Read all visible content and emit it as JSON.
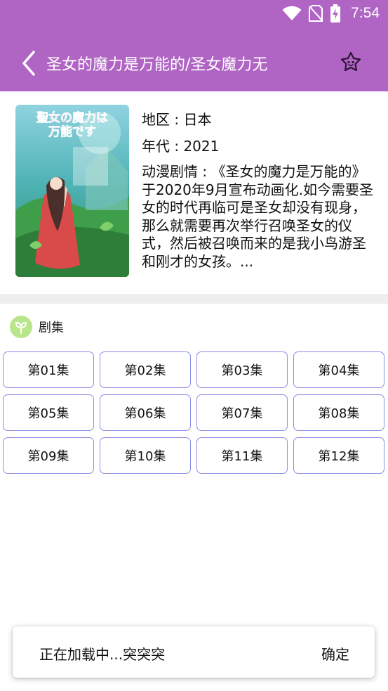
{
  "status_bar": {
    "time": "7:54",
    "icons": [
      "wifi-icon",
      "no-sim-icon",
      "battery-charging-icon"
    ]
  },
  "app_bar": {
    "title": "圣女的魔力是万能的/圣女魔力无",
    "back_icon": "back-chevron-icon",
    "favorite_icon": "star-face-icon"
  },
  "anime": {
    "poster": {
      "title_art": "聖女の魔力は万能です"
    },
    "region": "地区 : 日本",
    "year": "年代 : 2021",
    "synopsis": "动漫剧情 : 《圣女的魔力是万能的》于2020年9月宣布动画化.如今需要圣女的时代再临可是圣女却没有现身，那么就需要再次举行召唤圣女的仪式，然后被召唤而来的是我小鸟游圣和刚才的女孩。..."
  },
  "episodes_section": {
    "label": "剧集",
    "icon": "sprout-icon",
    "episodes": [
      "第01集",
      "第02集",
      "第03集",
      "第04集",
      "第05集",
      "第06集",
      "第07集",
      "第08集",
      "第09集",
      "第10集",
      "第11集",
      "第12集"
    ]
  },
  "toast": {
    "message": "正在加载中...突突突",
    "action": "确定"
  },
  "colors": {
    "header": "#b065c5",
    "episode_border": "#8d8ee6",
    "section_icon_bg": "#b9e68a",
    "divider": "#eeeeee"
  }
}
